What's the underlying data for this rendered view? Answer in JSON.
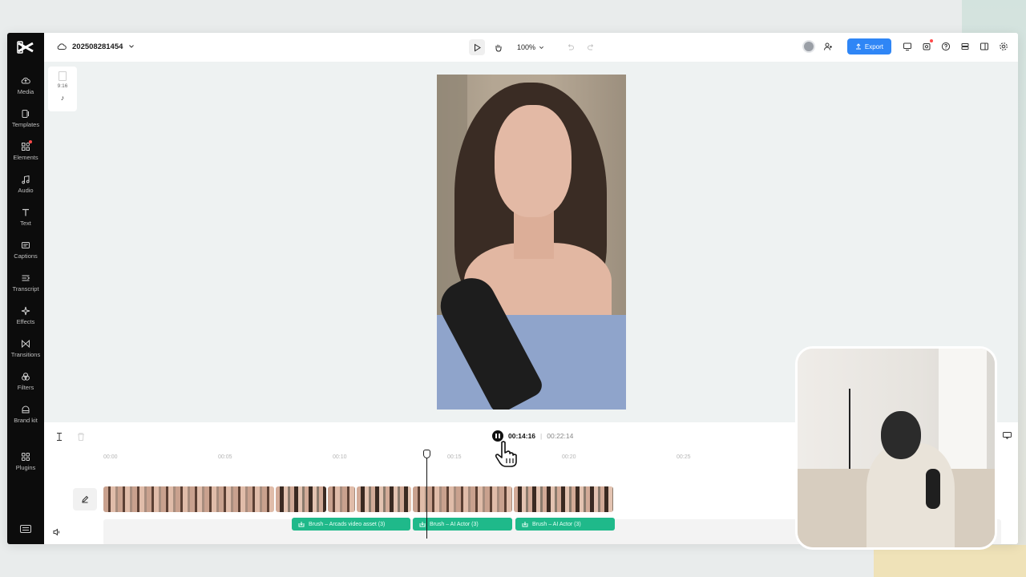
{
  "project": {
    "name": "202508281454"
  },
  "toolbar": {
    "zoom": "100%",
    "export_label": "Export"
  },
  "rail": {
    "items": [
      {
        "label": "Media",
        "icon": "cloud-upload-icon"
      },
      {
        "label": "Templates",
        "icon": "templates-icon"
      },
      {
        "label": "Elements",
        "icon": "elements-icon"
      },
      {
        "label": "Audio",
        "icon": "music-note-icon"
      },
      {
        "label": "Text",
        "icon": "text-icon"
      },
      {
        "label": "Captions",
        "icon": "captions-icon"
      },
      {
        "label": "Transcript",
        "icon": "transcript-icon"
      },
      {
        "label": "Effects",
        "icon": "sparkle-icon"
      },
      {
        "label": "Transitions",
        "icon": "transition-icon"
      },
      {
        "label": "Filters",
        "icon": "filters-icon"
      },
      {
        "label": "Brand kit",
        "icon": "brand-kit-icon"
      },
      {
        "label": "Plugins",
        "icon": "plugins-icon"
      }
    ]
  },
  "canvas": {
    "aspect_ratio": "9:16"
  },
  "playback": {
    "current_time": "00:14:16",
    "total_time": "00:22:14"
  },
  "ruler": {
    "ticks": [
      "00:00",
      "00:05",
      "00:10",
      "00:15",
      "00:20",
      "00:25"
    ]
  },
  "audio_clips": [
    {
      "label": "Brush – Arcads video asset (3)"
    },
    {
      "label": "Brush – AI Actor (3)"
    },
    {
      "label": "Brush – AI Actor (3)"
    }
  ],
  "colors": {
    "accent": "#2f86f6",
    "audio_clip": "#1fb98a",
    "rail_bg": "#0c0c0c"
  }
}
